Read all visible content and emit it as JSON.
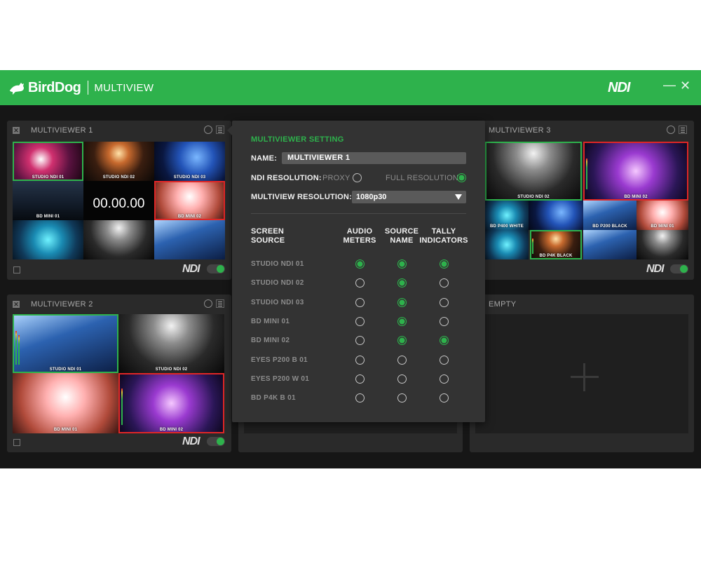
{
  "header": {
    "brand": "BirdDog",
    "app": "MULTIVIEW",
    "ndi_logo": "NDI",
    "min_icon": "—",
    "close_icon": "✕",
    "bg_color": "#2eb24c"
  },
  "panels": {
    "mv1": {
      "title": "MULTIVIEWER 1",
      "timer": "00.00.00",
      "ndi": "NDI",
      "labels": [
        "STUDIO NDI 01",
        "STUDIO NDI 02",
        "STUDIO NDI 03",
        "BD MINI 01",
        "BD MINI 02"
      ]
    },
    "mv2": {
      "title": "MULTIVIEWER 2",
      "ndi": "NDI",
      "labels": [
        "STUDIO NDI 01",
        "STUDIO NDI 02",
        "BD MINI 01",
        "BD MINI 02"
      ]
    },
    "mv3": {
      "title": "MULTIVIEWER 3",
      "ndi": "NDI",
      "labels": [
        "STUDIO NDI 02",
        "BD MINI 02",
        "BD P400 WHITE",
        "BD P200 BLACK",
        "BD MINI 01",
        "BD P4K BLACK"
      ]
    },
    "empty": {
      "title": "EMPTY"
    }
  },
  "settings": {
    "title": "MULTIVIEWER SETTING",
    "name_label": "NAME:",
    "name_value": "MULTIVIEWER 1",
    "ndi_res_label": "NDI RESOLUTION:",
    "proxy_label": "PROXY",
    "full_label": "FULL RESOLUTION",
    "mv_res_label": "MULTIVIEW RESOLUTION:",
    "mv_res_value": "1080p30",
    "columns": {
      "screen_source_1": "SCREEN",
      "screen_source_2": "SOURCE",
      "audio_1": "AUDIO",
      "audio_2": "METERS",
      "source_1": "SOURCE",
      "source_2": "NAME",
      "tally_1": "TALLY",
      "tally_2": "INDICATORS"
    },
    "sources": [
      {
        "name": "STUDIO NDI 01",
        "audio": true,
        "source_name": true,
        "tally": true
      },
      {
        "name": "STUDIO NDI 02",
        "audio": false,
        "source_name": true,
        "tally": false
      },
      {
        "name": "STUDIO NDI 03",
        "audio": false,
        "source_name": true,
        "tally": false
      },
      {
        "name": "BD MINI 01",
        "audio": false,
        "source_name": true,
        "tally": false
      },
      {
        "name": "BD MINI 02",
        "audio": false,
        "source_name": true,
        "tally": true
      },
      {
        "name": "EYES P200 B 01",
        "audio": false,
        "source_name": false,
        "tally": false
      },
      {
        "name": "EYES P200 W 01",
        "audio": false,
        "source_name": false,
        "tally": false
      },
      {
        "name": "BD P4K B 01",
        "audio": false,
        "source_name": false,
        "tally": false
      }
    ]
  }
}
